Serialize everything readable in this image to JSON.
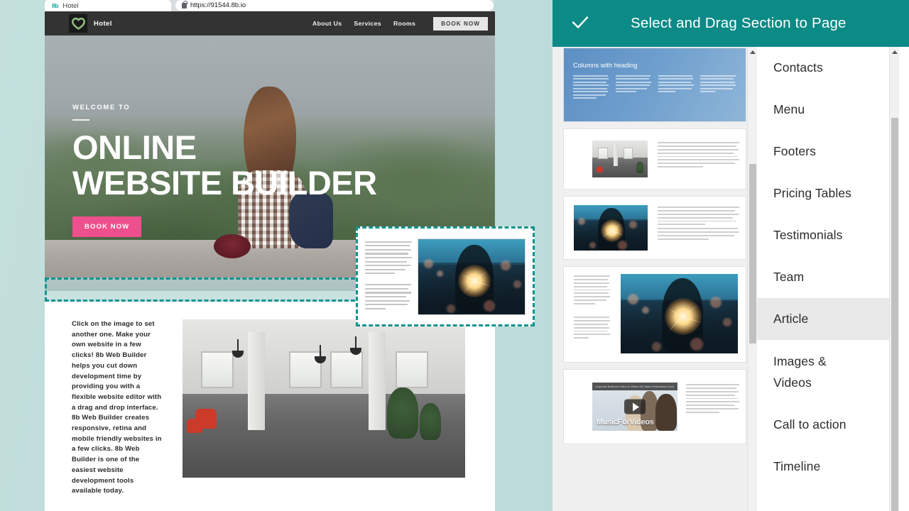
{
  "browser": {
    "tab_favicon": "8b",
    "tab_title": "Hotel",
    "url": "https://91544.8b.io",
    "lock_icon": "lock-icon"
  },
  "site": {
    "brand_name": "Hotel",
    "logo_icon": "heart-leaf-logo-icon",
    "nav": [
      {
        "label": "About Us"
      },
      {
        "label": "Services"
      },
      {
        "label": "Rooms"
      }
    ],
    "nav_cta": "BOOK NOW",
    "hero": {
      "kicker": "WELCOME TO",
      "title_line1": "ONLINE",
      "title_line2": "WEBSITE BUILDER",
      "cta": "BOOK NOW"
    },
    "article": {
      "paragraph": "Click on the image to set another one. Make your own website in a few clicks! 8b Web Builder helps you cut down development time by providing you with a flexible website editor with a drag and drop interface. 8b Web Builder creates responsive, retina and mobile friendly websites in a few clicks. 8b Web Builder is one of the easiest website development tools available today."
    },
    "drop_zone_label": "section-drop-placeholder"
  },
  "drag_ghost": {
    "label": "dragged-article-section-preview",
    "image_alt": "sparkler-photo"
  },
  "panel": {
    "header_title": "Select and  Drag Section to  Page",
    "header_icon": "check-icon",
    "accent_color": "#0b8a86",
    "thumbnails": [
      {
        "name": "columns-with-heading",
        "title": "Columns with heading",
        "columns": 4
      },
      {
        "name": "image-left-text-right",
        "title": "",
        "columns": 0
      },
      {
        "name": "sparkler-image-left-text-right",
        "title": "",
        "columns": 0
      },
      {
        "name": "text-left-sparkler-image-right",
        "title": "",
        "columns": 0
      },
      {
        "name": "video-left-text-right",
        "title": "",
        "video_bar_text": "Corporate Business Video on Where the Sales Presentation Goes",
        "watermark": "MusicForVideos"
      }
    ],
    "categories": [
      {
        "label": "Contacts",
        "active": false
      },
      {
        "label": "Menu",
        "active": false
      },
      {
        "label": "Footers",
        "active": false
      },
      {
        "label": "Pricing Tables",
        "active": false
      },
      {
        "label": "Testimonials",
        "active": false
      },
      {
        "label": "Team",
        "active": false
      },
      {
        "label": "Article",
        "active": true
      },
      {
        "label": "Images &\nVideos",
        "active": false
      },
      {
        "label": "Call to action",
        "active": false
      },
      {
        "label": "Timeline",
        "active": false
      }
    ],
    "scrollbars": {
      "thumbs_name": "thumbnails-scrollbar",
      "list_name": "categories-scrollbar"
    }
  }
}
